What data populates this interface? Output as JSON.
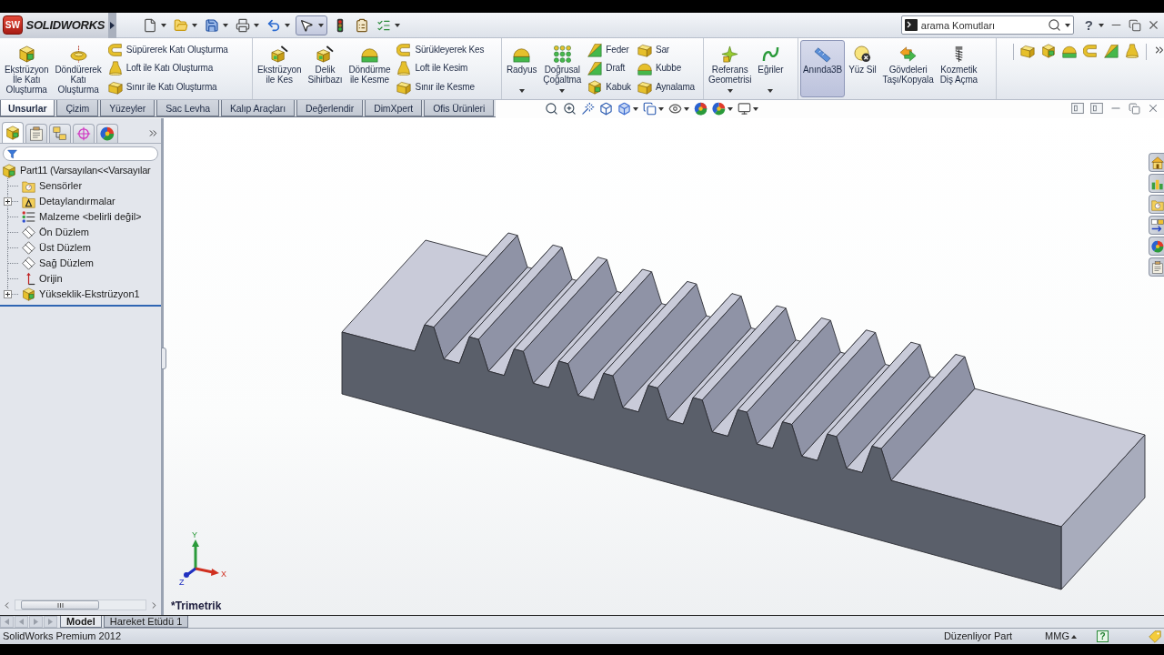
{
  "title_bar": {
    "logo_badge": "SW",
    "logo": "SOLIDWORKS",
    "select_tool": {
      "on": true
    },
    "search": {
      "placeholder": "arama Komutları"
    },
    "help": "?"
  },
  "ribbon": {
    "groups": [
      {
        "large": [
          {
            "label": "Ekstrüzyon\nİle Katı\nOluşturma",
            "dropdown": false,
            "on": false
          },
          {
            "label": "Döndürerek\nKatı\nOluşturma",
            "dropdown": false,
            "on": false
          }
        ],
        "small_columns": [
          [
            "Süpürerek Katı Oluşturma",
            "Loft ile Katı Oluşturma",
            "Sınır ile Katı Oluşturma"
          ]
        ]
      },
      {
        "large": [
          {
            "label": "Ekstrüzyon\nile Kes",
            "dropdown": false,
            "on": false
          },
          {
            "label": "Delik\nSihirbazı",
            "dropdown": false,
            "on": false
          },
          {
            "label": "Döndürme\nile Kesme",
            "dropdown": false,
            "on": false
          }
        ],
        "small_columns": [
          [
            "Sürükleyerek Kes",
            "Loft ile Kesim",
            "Sınır ile Kesme"
          ]
        ]
      },
      {
        "large": [
          {
            "label": "Radyus",
            "dropdown": true,
            "on": false
          },
          {
            "label": "Doğrusal\nÇoğaltma",
            "dropdown": true,
            "on": false
          }
        ],
        "small_columns": [
          [
            "Feder",
            "Draft",
            "Kabuk"
          ],
          [
            "Sar",
            "Kubbe",
            "Aynalama"
          ]
        ]
      },
      {
        "large": [
          {
            "label": "Referans\nGeometrisi",
            "dropdown": true,
            "on": false
          },
          {
            "label": "Eğriler",
            "dropdown": true,
            "on": false
          }
        ]
      },
      {
        "large": [
          {
            "label": "Anında3B",
            "dropdown": false,
            "on": true
          },
          {
            "label": "Yüz Sil",
            "dropdown": false,
            "on": false
          },
          {
            "label": "Gövdeleri\nTaşı/Kopyala",
            "dropdown": false,
            "on": false
          },
          {
            "label": "Kozmetik\nDiş Açma",
            "dropdown": false,
            "on": false
          }
        ]
      }
    ]
  },
  "command_tabs": [
    {
      "label": "Unsurlar",
      "selected": true
    },
    {
      "label": "Çizim",
      "selected": false
    },
    {
      "label": "Yüzeyler",
      "selected": false
    },
    {
      "label": "Sac Levha",
      "selected": false
    },
    {
      "label": "Kalıp Araçları",
      "selected": false
    },
    {
      "label": "Değerlendir",
      "selected": false
    },
    {
      "label": "DimXpert",
      "selected": false
    },
    {
      "label": "Ofis Ürünleri",
      "selected": false
    }
  ],
  "feature_manager": {
    "panel_tabs": [
      {
        "selected": true
      },
      {
        "selected": false
      },
      {
        "selected": false
      },
      {
        "selected": false
      },
      {
        "selected": false
      }
    ],
    "tree": {
      "label": "Part11 (Varsayılan<<Varsayılar",
      "children": [
        {
          "label": "Sensörler",
          "kind": "sensors",
          "expandable": false
        },
        {
          "label": "Detaylandırmalar",
          "kind": "annotations",
          "expandable": true
        },
        {
          "label": "Malzeme <belirli değil>",
          "kind": "material",
          "expandable": false
        },
        {
          "label": "Ön Düzlem",
          "kind": "plane",
          "expandable": false
        },
        {
          "label": "Üst Düzlem",
          "kind": "plane",
          "expandable": false
        },
        {
          "label": "Sağ Düzlem",
          "kind": "plane",
          "expandable": false
        },
        {
          "label": "Orijin",
          "kind": "origin",
          "expandable": false
        },
        {
          "label": "Yükseklik-Ekstrüzyon1",
          "kind": "feature",
          "expandable": true
        }
      ]
    }
  },
  "viewport": {
    "view_name": "*Trimetrik",
    "triad_labels": [
      "Y",
      "X",
      "Z"
    ]
  },
  "bottom_tabs": [
    {
      "label": "Model",
      "selected": true
    },
    {
      "label": "Hareket Etüdü 1",
      "selected": false
    }
  ],
  "status_bar": {
    "product": "SolidWorks Premium 2012",
    "mode": "Düzenliyor Part",
    "units": "MMG",
    "help": "?"
  }
}
